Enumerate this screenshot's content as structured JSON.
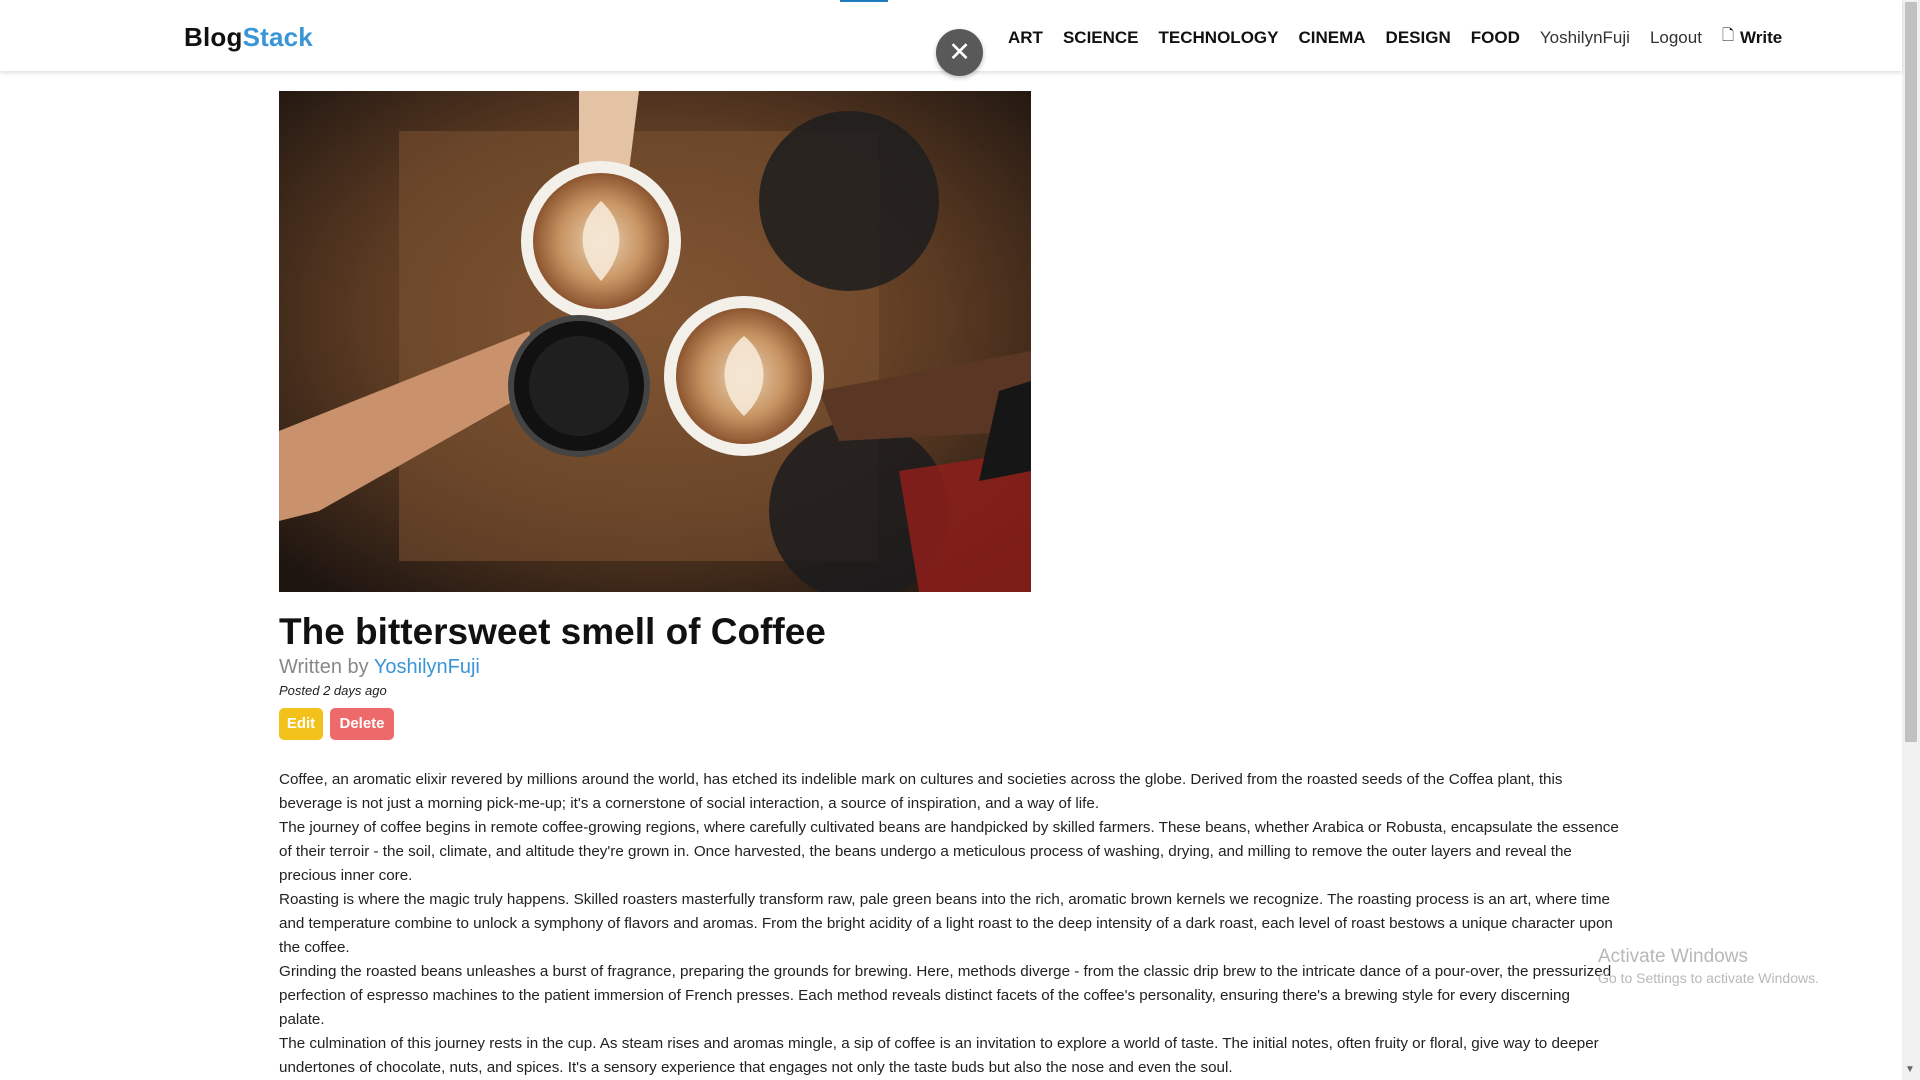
{
  "brand": {
    "part1": "Blog",
    "part2": "Stack"
  },
  "nav": {
    "categories": [
      "ART",
      "SCIENCE",
      "TECHNOLOGY",
      "CINEMA",
      "DESIGN",
      "FOOD"
    ],
    "username": "YoshilynFuji",
    "logout": "Logout",
    "write": "Write",
    "write_icon": "document-icon",
    "close_icon": "close-icon"
  },
  "post": {
    "image_description_icon": "coffee-photo",
    "title": "The bittersweet smell of Coffee",
    "written_by": "Written by",
    "author": "YoshilynFuji",
    "posted": "Posted 2 days ago",
    "edit_label": "Edit",
    "delete_label": "Delete",
    "paragraphs": [
      "Coffee, an aromatic elixir revered by millions around the world, has etched its indelible mark on cultures and societies across the globe. Derived from the roasted seeds of the Coffea plant, this beverage is not just a morning pick-me-up; it's a cornerstone of social interaction, a source of inspiration, and a way of life.",
      "The journey of coffee begins in remote coffee-growing regions, where carefully cultivated beans are handpicked by skilled farmers. These beans, whether Arabica or Robusta, encapsulate the essence of their terroir - the soil, climate, and altitude they're grown in. Once harvested, the beans undergo a meticulous process of washing, drying, and milling to remove the outer layers and reveal the precious inner core.",
      "Roasting is where the magic truly happens. Skilled roasters masterfully transform raw, pale green beans into the rich, aromatic brown kernels we recognize. The roasting process is an art, where time and temperature combine to unlock a symphony of flavors and aromas. From the bright acidity of a light roast to the deep intensity of a dark roast, each level of roast bestows a unique character upon the coffee.",
      "Grinding the roasted beans unleashes a burst of fragrance, preparing the grounds for brewing. Here, methods diverge - from the classic drip brew to the intricate dance of a pour-over, the pressurized perfection of espresso machines to the patient immersion of French presses. Each method reveals distinct facets of the coffee's personality, ensuring there's a brewing style for every discerning palate.",
      "The culmination of this journey rests in the cup. As steam rises and aromas mingle, a sip of coffee is an invitation to explore a world of taste. The initial notes, often fruity or floral, give way to deeper undertones of chocolate, nuts, and spices. It's a sensory experience that engages not only the taste buds but also the nose and even the soul."
    ]
  },
  "watermark": {
    "line1": "Activate Windows",
    "line2": "Go to Settings to activate Windows."
  },
  "colors": {
    "brand_accent": "#3a95d6",
    "edit_button": "#f2c21b",
    "delete_button": "#ee6a6a"
  }
}
